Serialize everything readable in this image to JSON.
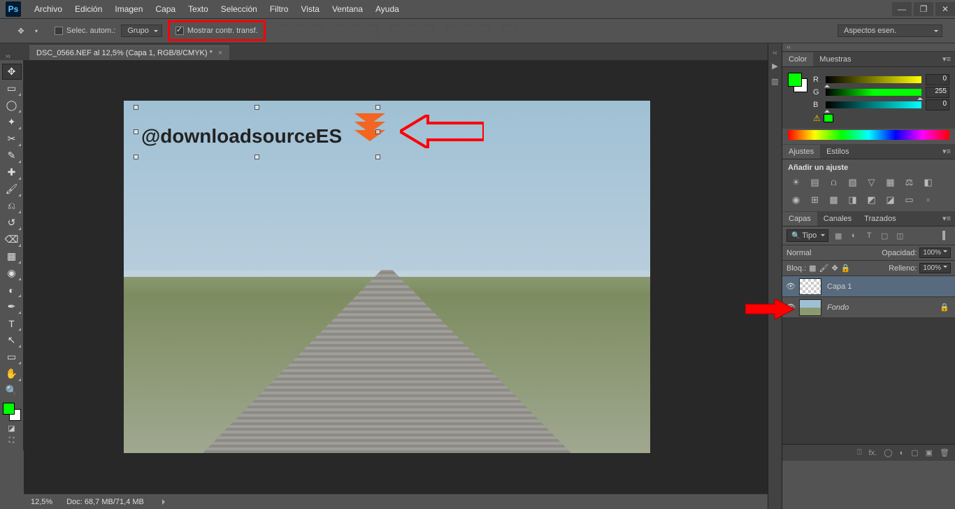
{
  "app": {
    "logo": "Ps"
  },
  "menu": [
    "Archivo",
    "Edición",
    "Imagen",
    "Capa",
    "Texto",
    "Selección",
    "Filtro",
    "Vista",
    "Ventana",
    "Ayuda"
  ],
  "options": {
    "auto_select_label": "Selec. autom.:",
    "group_dd": "Grupo",
    "show_transform_label": "Mostrar contr. transf.",
    "view_dd": "Aspectos esen."
  },
  "document": {
    "tab_title": "DSC_0566.NEF al 12,5% (Capa 1, RGB/8/CMYK) *",
    "overlay_text": "@downloadsourceES"
  },
  "status": {
    "zoom": "12,5%",
    "doc": "Doc: 68,7 MB/71,4 MB"
  },
  "panels": {
    "color": {
      "tab1": "Color",
      "tab2": "Muestras",
      "r_label": "R",
      "r_val": "0",
      "g_label": "G",
      "g_val": "255",
      "b_label": "B",
      "b_val": "0"
    },
    "adjust": {
      "tab1": "Ajustes",
      "tab2": "Estilos",
      "title": "Añadir un ajuste"
    },
    "layers": {
      "tab1": "Capas",
      "tab2": "Canales",
      "tab3": "Trazados",
      "filter_dd": "Tipo",
      "blend_dd": "Normal",
      "opacity_label": "Opacidad:",
      "opacity_val": "100%",
      "lock_label": "Bloq.:",
      "fill_label": "Relleno:",
      "fill_val": "100%",
      "layer1_name": "Capa 1",
      "layer2_name": "Fondo",
      "fx_label": "fx."
    }
  }
}
